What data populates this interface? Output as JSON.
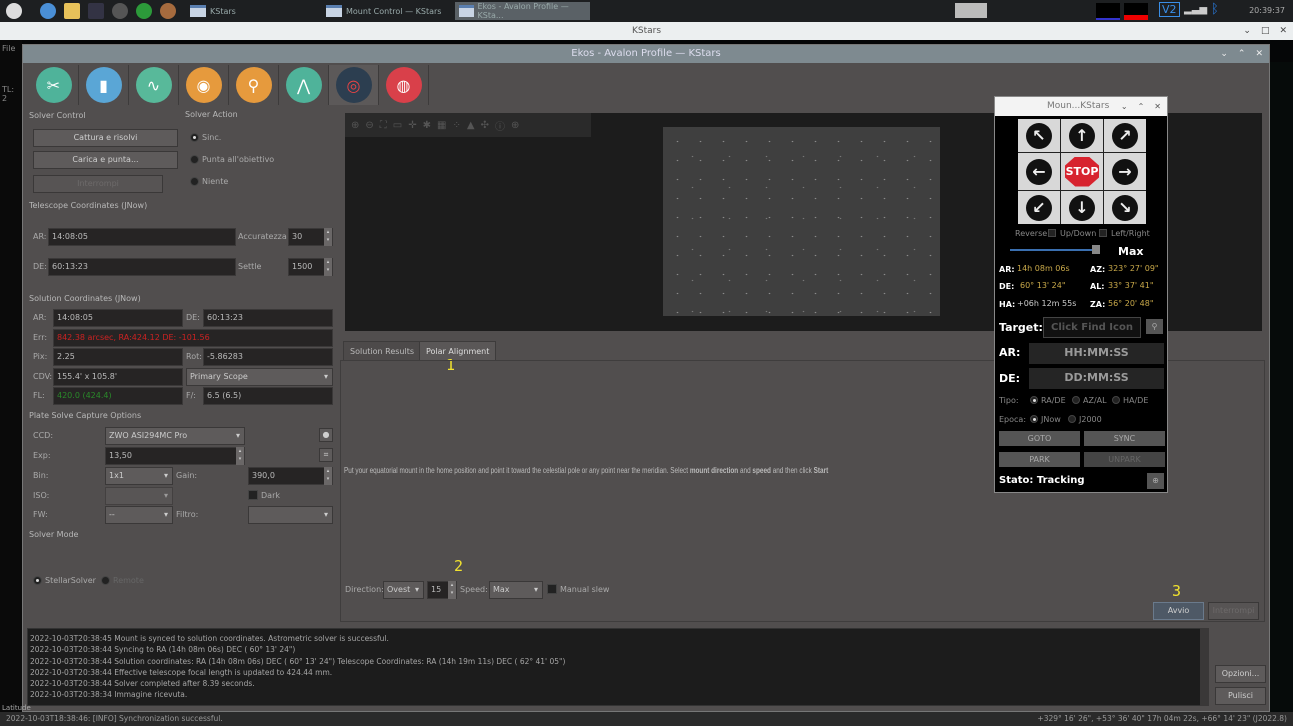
{
  "taskbar": {
    "windows": [
      {
        "label": "KStars"
      },
      {
        "label": "Mount Control — KStars"
      },
      {
        "label": "Ekos - Avalon Profile — KSta..."
      }
    ],
    "clock": "20:39:37",
    "tray_label": "V2"
  },
  "kstars_window": {
    "title": "KStars",
    "left_strip": [
      "File",
      "TL: 2"
    ]
  },
  "ekos_window": {
    "title": "Ekos - Avalon Profile — KStars",
    "modules": [
      {
        "name": "setup",
        "color": "#4fb39a"
      },
      {
        "name": "scheduler",
        "color": "#5aa6d6"
      },
      {
        "name": "analyze",
        "color": "#58b99a"
      },
      {
        "name": "capture",
        "color": "#e69a3d"
      },
      {
        "name": "focus",
        "color": "#e69a3d"
      },
      {
        "name": "mount",
        "color": "#4fb39a"
      },
      {
        "name": "align",
        "color": "#2c3e50"
      },
      {
        "name": "guide",
        "color": "#d9404a"
      }
    ]
  },
  "solver_control": {
    "title": "Solver Control",
    "capture_solve": "Cattura e risolvi",
    "load_slew": "Carica e punta...",
    "stop": "Interrompi"
  },
  "solver_action": {
    "title": "Solver Action",
    "options": [
      "Sinc.",
      "Punta all'obiettivo",
      "Niente"
    ],
    "selected": "Sinc."
  },
  "telescope_coords": {
    "title": "Telescope Coordinates (JNow)",
    "ra_label": "AR:",
    "ra": "14:08:05",
    "de_label": "DE:",
    "de": "60:13:23",
    "accuracy_label": "Accuratezza",
    "accuracy": "30",
    "settle_label": "Settle",
    "settle": "1500"
  },
  "solution_coords": {
    "title": "Solution Coordinates (JNow)",
    "ra_label": "AR:",
    "ra": "14:08:05",
    "de_label": "DE:",
    "de": "60:13:23",
    "err_label": "Err:",
    "err": "842.38 arcsec, RA:424.12 DE: -101.56",
    "pix_label": "Pix:",
    "pix": "2.25",
    "rot_label": "Rot:",
    "rot": "-5.86283",
    "fov_label": "CDV:",
    "fov": "155.4' x 105.8'",
    "scope": "Primary Scope",
    "fl_label": "FL:",
    "fl": "420.0 (424.4)",
    "fratio_label": "F/:",
    "fratio": "6.5 (6.5)"
  },
  "capture_options": {
    "title": "Plate Solve Capture Options",
    "ccd_label": "CCD:",
    "ccd": "ZWO ASI294MC Pro",
    "exp_label": "Exp:",
    "exp": "13,50",
    "bin_label": "Bin:",
    "bin": "1x1",
    "gain_label": "Gain:",
    "gain": "390,0",
    "iso_label": "ISO:",
    "dark_label": "Dark",
    "fw_label": "FW:",
    "fw": "--",
    "filter_label": "Filtro:"
  },
  "solver_mode": {
    "title": "Solver Mode",
    "options": [
      "StellarSolver",
      "Remote"
    ],
    "selected": "StellarSolver"
  },
  "tabs": [
    {
      "label": "Solution Results"
    },
    {
      "label": "Polar Alignment",
      "active": true
    }
  ],
  "polar_alignment": {
    "instructions_pre": "Put your equatorial mount in the home position and point it toward the celestial pole or any point near the meridian. Select ",
    "bold1": "mount direction",
    "mid": " and ",
    "bold2": "speed",
    "post": " and then click ",
    "bold3": "Start",
    "direction_label": "Direction:",
    "direction": "Ovest",
    "degrees": "15",
    "speed_label": "Speed:",
    "speed": "Max",
    "manual_slew": "Manual slew",
    "start": "Avvio",
    "refresh": "Interrompi"
  },
  "annotations": [
    "1",
    "2",
    "3"
  ],
  "log": {
    "lines": [
      "2022-10-03T20:38:45 Mount is synced to solution coordinates. Astrometric solver is successful.",
      "2022-10-03T20:38:44 Syncing to RA (14h 08m 06s) DEC ( 60° 13' 24\")",
      "2022-10-03T20:38:44 Solution coordinates: RA (14h 08m 06s) DEC ( 60° 13' 24\") Telescope Coordinates: RA (14h 19m 11s) DEC ( 62° 41' 05\")",
      "2022-10-03T20:38:44 Effective telescope focal length is updated to 424.44 mm.",
      "2022-10-03T20:38:44 Solver completed after 8.39 seconds.",
      "2022-10-03T20:38:34 Immagine ricevuta."
    ],
    "options": "Opzioni...",
    "clear": "Pulisci"
  },
  "statusbar": {
    "message": "2022-10-03T18:38:46: [INFO] Synchronization successful.",
    "coords": "+329° 16' 26\", +53° 36' 40\"  17h 04m 22s, +66° 14' 23\" (J2022.8)",
    "left_label": "Latitude"
  },
  "mount_control": {
    "title": "Moun...KStars",
    "reverse_label": "Reverse",
    "updown": "Up/Down",
    "leftright": "Left/Right",
    "speed": "Max",
    "speed_fraction": 0.95,
    "ar_label": "AR:",
    "ar": "14h 08m 06s",
    "az_label": "AZ:",
    "az": "323° 27' 09\"",
    "de_label": "DE:",
    "de": "60° 13' 24\"",
    "al_label": "AL:",
    "al": "33° 37' 41\"",
    "ha_label": "HA:",
    "ha": "+06h 12m 55s",
    "za_label": "ZA:",
    "za": "56° 20' 48\"",
    "target_label": "Target:",
    "target_placeholder": "Click Find Icon",
    "ra_in_label": "AR:",
    "ra_placeholder": "HH:MM:SS",
    "de_in_label": "DE:",
    "de_placeholder": "DD:MM:SS",
    "type_label": "Tipo:",
    "types": [
      "RA/DE",
      "AZ/AL",
      "HA/DE"
    ],
    "epoch_label": "Epoca:",
    "epochs": [
      "JNow",
      "J2000"
    ],
    "goto": "GOTO",
    "sync": "SYNC",
    "park": "PARK",
    "unpark": "UNPARK",
    "stop": "STOP",
    "status": "Stato: Tracking"
  }
}
